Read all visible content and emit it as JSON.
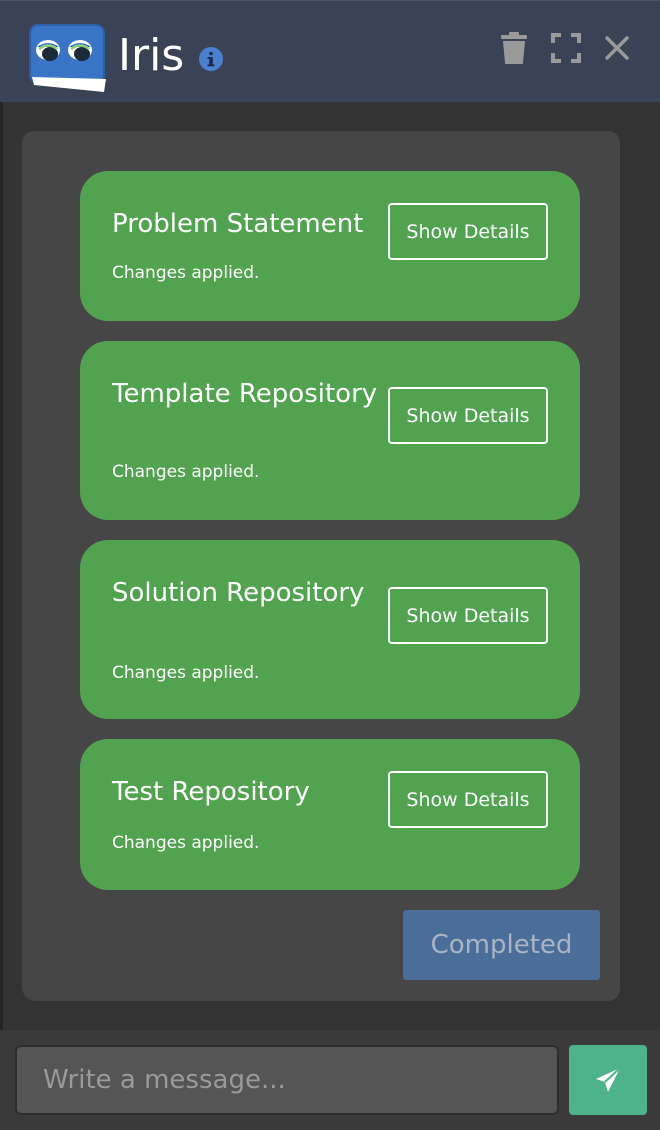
{
  "header": {
    "title": "Iris",
    "logo_icon": "iris-robot-logo",
    "info_icon": "info-circle-icon",
    "actions": [
      {
        "name": "trash-icon",
        "label": "Delete chat"
      },
      {
        "name": "expand-icon",
        "label": "Fullscreen"
      },
      {
        "name": "close-icon",
        "label": "Close"
      }
    ]
  },
  "message": {
    "cards": [
      {
        "title": "Problem Statement",
        "status": "Changes applied.",
        "button": "Show Details"
      },
      {
        "title": "Template Repository",
        "status": "Changes applied.",
        "button": "Show Details"
      },
      {
        "title": "Solution Repository",
        "status": "Changes applied.",
        "button": "Show Details"
      },
      {
        "title": "Test Repository",
        "status": "Changes applied.",
        "button": "Show Details"
      }
    ],
    "completed_label": "Completed"
  },
  "composer": {
    "placeholder": "Write a message...",
    "value": "",
    "send_icon": "paper-plane-icon"
  },
  "colors": {
    "header_bg": "#394355",
    "card_green": "#52a350",
    "completed_blue": "#4b6d99",
    "send_green": "#4eb38a"
  }
}
